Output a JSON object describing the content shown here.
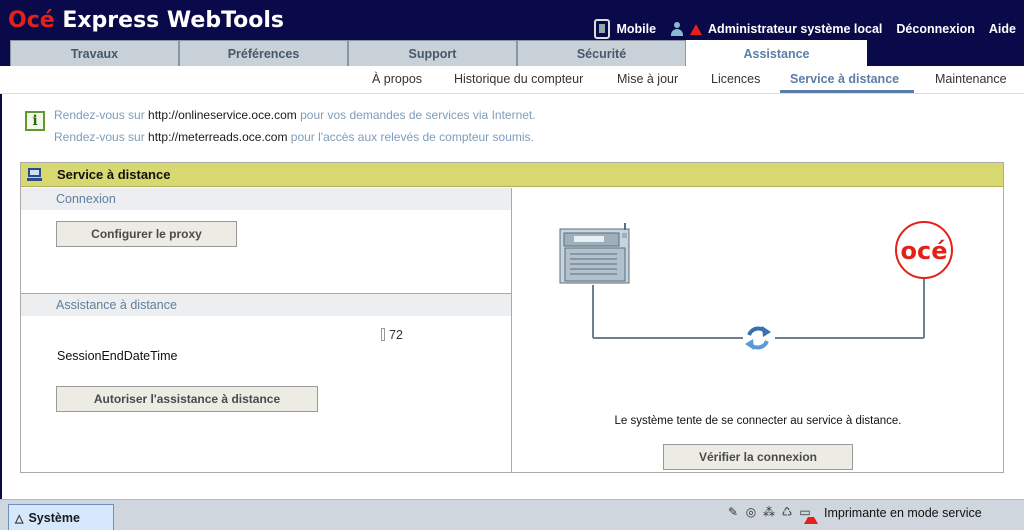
{
  "header": {
    "brand": "Océ",
    "product": " Express WebTools",
    "links": {
      "mobile": "Mobile",
      "user": "Administrateur système local",
      "logout": "Déconnexion",
      "help": "Aide"
    }
  },
  "tabs": [
    {
      "label": "Travaux"
    },
    {
      "label": "Préférences"
    },
    {
      "label": "Support"
    },
    {
      "label": "Sécurité"
    },
    {
      "label": "Assistance",
      "active": true
    }
  ],
  "subnav": [
    {
      "label": "À propos"
    },
    {
      "label": "Historique du compteur"
    },
    {
      "label": "Mise à jour"
    },
    {
      "label": "Licences"
    },
    {
      "label": "Service à distance",
      "active": true
    },
    {
      "label": "Maintenance"
    }
  ],
  "info": {
    "line1_prefix": "Rendez-vous sur ",
    "line1_url": "http://onlineservice.oce.com",
    "line1_suffix": " pour vos demandes de services via Internet.",
    "line2_prefix": "Rendez-vous sur ",
    "line2_url": "http://meterreads.oce.com",
    "line2_suffix": " pour l'accès aux relevés de compteur soumis."
  },
  "panel": {
    "title": "Service à distance",
    "connection": {
      "heading": "Connexion",
      "proxy_button": "Configurer le proxy"
    },
    "remote_assistance": {
      "heading": "Assistance à distance",
      "session_label": "SessionEndDateTime",
      "hours_value": "72",
      "authorize_button": "Autoriser l'assistance à distance"
    },
    "diagram": {
      "logo_text": "océ",
      "status_text": "Le système tente de se connecter au service à distance.",
      "verify_button": "Vérifier la connexion"
    }
  },
  "bottom": {
    "system_tab": "Système",
    "printer_status": "Imprimante en mode service"
  },
  "colors": {
    "header_bg": "#0a0a4a",
    "brand_red": "#e32119",
    "accent_blue": "#5a7ea8",
    "panel_head_bg": "#d8d870"
  }
}
